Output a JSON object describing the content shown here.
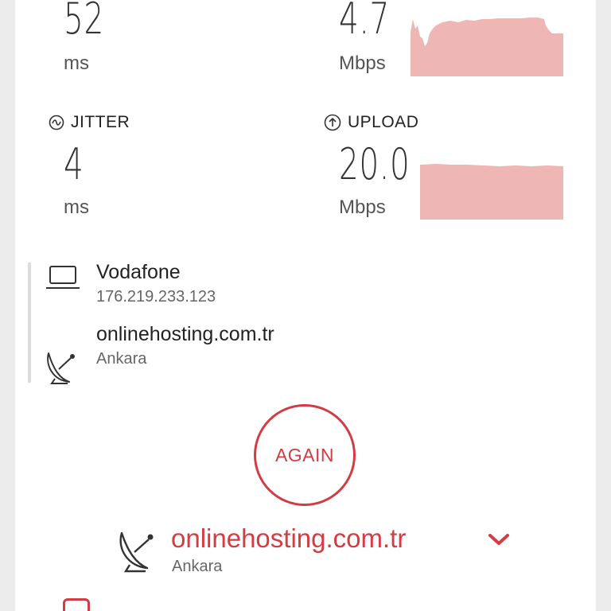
{
  "ping": {
    "value": "52",
    "unit": "ms"
  },
  "download": {
    "value": "4.7",
    "unit": "Mbps"
  },
  "jitter": {
    "label": "JITTER",
    "value": "4",
    "unit": "ms",
    "icon": "wave-icon"
  },
  "upload": {
    "label": "UPLOAD",
    "value": "20.0",
    "unit": "Mbps",
    "icon": "arrow-up-circle-icon"
  },
  "provider": {
    "name": "Vodafone",
    "ip": "176.219.233.123",
    "icon": "laptop-icon"
  },
  "host": {
    "name": "onlinehosting.com.tr",
    "location": "Ankara",
    "icon": "satellite-dish-icon"
  },
  "again_label": "AGAIN",
  "server": {
    "name": "onlinehosting.com.tr",
    "location": "Ankara"
  },
  "colors": {
    "accent": "#d33c43",
    "graph_fill": "#efb6b6"
  }
}
